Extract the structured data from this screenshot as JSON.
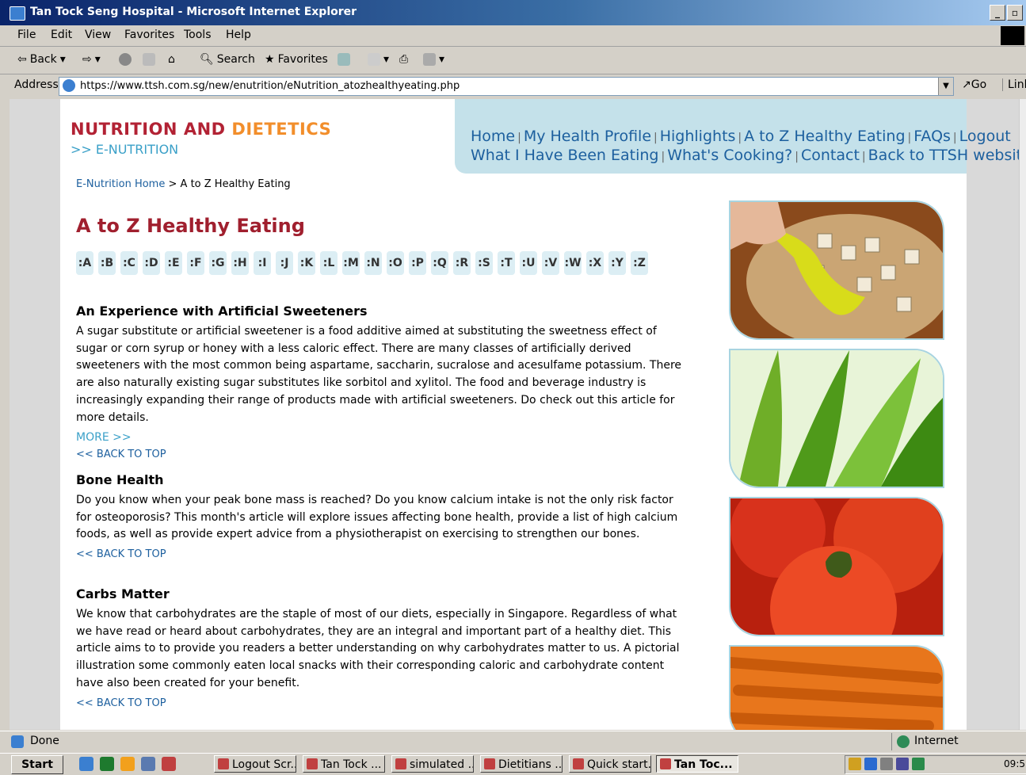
{
  "window": {
    "title": "Tan Tock Seng Hospital - Microsoft Internet Explorer"
  },
  "menubar": {
    "items": [
      "File",
      "Edit",
      "View",
      "Favorites",
      "Tools",
      "Help"
    ]
  },
  "toolbar": {
    "back": "Back",
    "search": "Search",
    "favorites": "Favorites"
  },
  "address": {
    "label": "Address",
    "url": "https://www.ttsh.com.sg/new/enutrition/eNutrition_atozhealthyeating.php",
    "go": "Go",
    "links": "Link"
  },
  "site": {
    "logo_main": "NUTRITION AND",
    "logo_accent": "DIETETICS",
    "logo_sub": ">> E-NUTRITION"
  },
  "nav": {
    "row1": [
      "Home",
      "My Health Profile",
      "Highlights",
      "A to Z Healthy Eating",
      "FAQs",
      "Logout"
    ],
    "row2": [
      "What I Have Been Eating",
      "What's Cooking?",
      "Contact",
      "Back to TTSH website"
    ]
  },
  "breadcrumb": {
    "home": "E-Nutrition Home",
    "sep": ">",
    "current": "A to Z Healthy Eating"
  },
  "page_title": "A to Z Healthy Eating",
  "alphabet": [
    ":A",
    ":B",
    ":C",
    ":D",
    ":E",
    ":F",
    ":G",
    ":H",
    ":I",
    ":J",
    ":K",
    ":L",
    ":M",
    ":N",
    ":O",
    ":P",
    ":Q",
    ":R",
    ":S",
    ":T",
    ":U",
    ":V",
    ":W",
    ":X",
    ":Y",
    ":Z"
  ],
  "articles": [
    {
      "title": "An Experience with Artificial Sweeteners",
      "body": "A sugar substitute or artificial sweetener is a food additive aimed at substituting the sweetness effect of sugar or corn syrup or honey with a less caloric effect. There are many classes of artificially derived sweeteners with the most common being aspartame, saccharin, sucralose and acesulfame potassium. There are also naturally existing sugar substitutes like sorbitol and xylitol. The food and beverage industry is increasingly expanding their range of products made with artificial sweeteners. Do check out this article for more details.",
      "more": "MORE >>",
      "back": "<< BACK TO TOP"
    },
    {
      "title": "Bone Health",
      "body": "Do you know when your peak bone mass is reached? Do you know calcium intake is not the only risk factor for osteoporosis? This month's article will explore issues affecting bone health, provide a list of high calcium foods, as well as provide expert advice from a physiotherapist on exercising to strengthen our bones.",
      "back": "<< BACK TO TOP"
    },
    {
      "title": "Carbs Matter",
      "body": "We know that carbohydrates are the staple of most of our diets, especially in Singapore. Regardless of what we have read or heard about carbohydrates, they are an integral and important part of a healthy diet. This article aims to to provide you readers a better understanding on why carbohydrates matter to us. A pictorial illustration some commonly eaten local snacks with their corresponding caloric and carbohydrate content have also been created for your benefit.",
      "back": "<< BACK TO TOP"
    }
  ],
  "status": {
    "text": "Done",
    "zone": "Internet"
  },
  "taskbar": {
    "start": "Start",
    "buttons": [
      "Logout Scr...",
      "Tan Tock ...",
      "simulated ...",
      "Dietitians ...",
      "Quick start...",
      "Tan Toc..."
    ],
    "clock": "09:5"
  }
}
